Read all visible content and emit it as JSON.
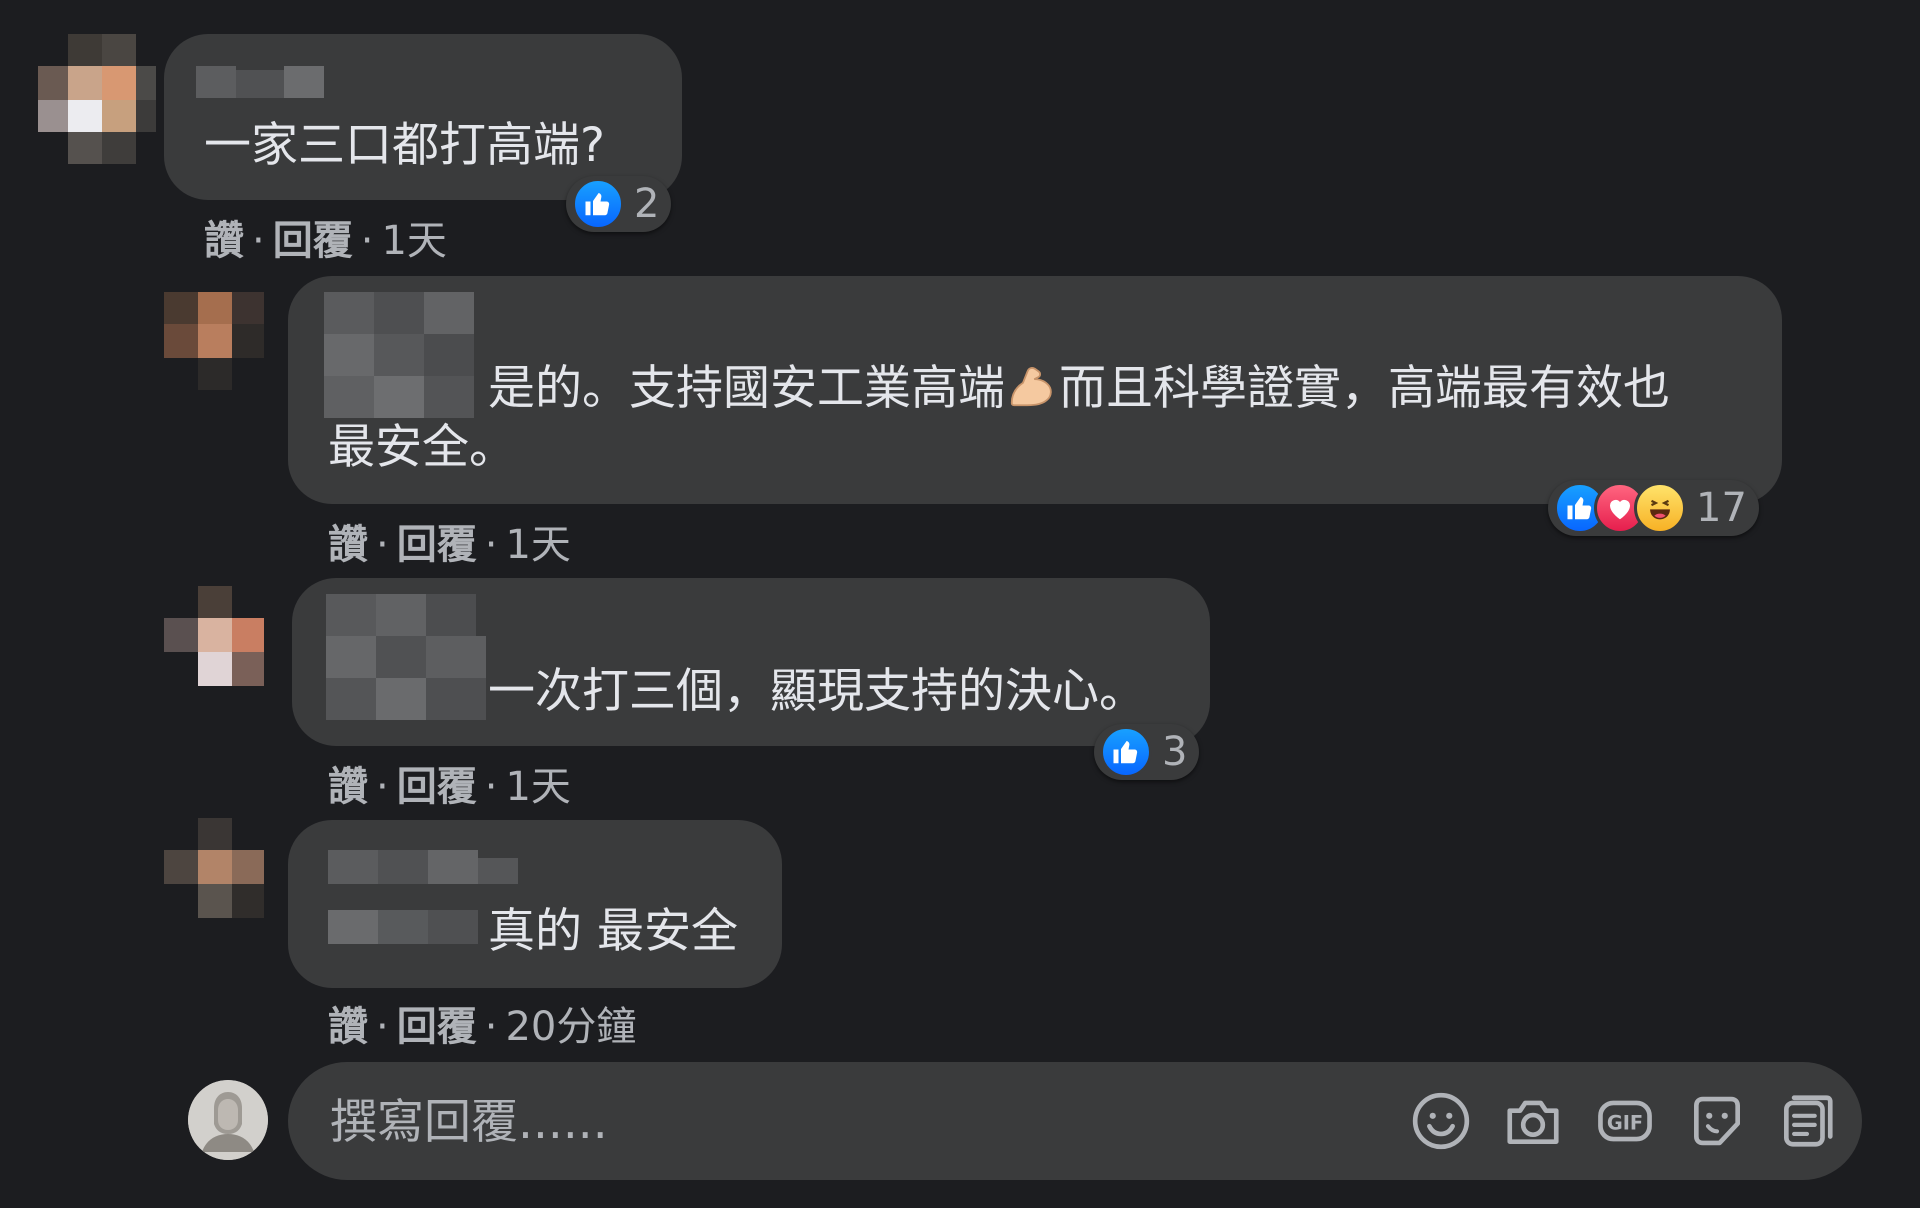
{
  "comments": [
    {
      "text": "一家三口都打高端?",
      "actions": {
        "like": "讚",
        "reply": "回覆",
        "time": "1天"
      },
      "reactions": {
        "types": [
          "like"
        ],
        "count": "2"
      }
    },
    {
      "text_line1a": "是的。支持國安工業高端",
      "emoji": "muscle-emoji",
      "text_line1b": "而且科學證實，高端最有效也",
      "text_line2": "最安全。",
      "actions": {
        "like": "讚",
        "reply": "回覆",
        "time": "1天"
      },
      "reactions": {
        "types": [
          "like",
          "love",
          "haha"
        ],
        "count": "17"
      }
    },
    {
      "text": "一次打三個，顯現支持的決心。",
      "actions": {
        "like": "讚",
        "reply": "回覆",
        "time": "1天"
      },
      "reactions": {
        "types": [
          "like"
        ],
        "count": "3"
      }
    },
    {
      "text": "真的 最安全",
      "actions": {
        "like": "讚",
        "reply": "回覆",
        "time": "20分鐘"
      }
    }
  ],
  "reply_box": {
    "placeholder": "撰寫回覆......",
    "tools": [
      "emoji-icon",
      "camera-icon",
      "gif-icon",
      "sticker-icon",
      "avatar-sticker-icon"
    ]
  },
  "colors": {
    "background": "#1c1d20",
    "bubble": "#3a3b3c",
    "text": "#e4e6eb",
    "secondary": "#b0b3b8",
    "like_blue": "#0866ff"
  }
}
